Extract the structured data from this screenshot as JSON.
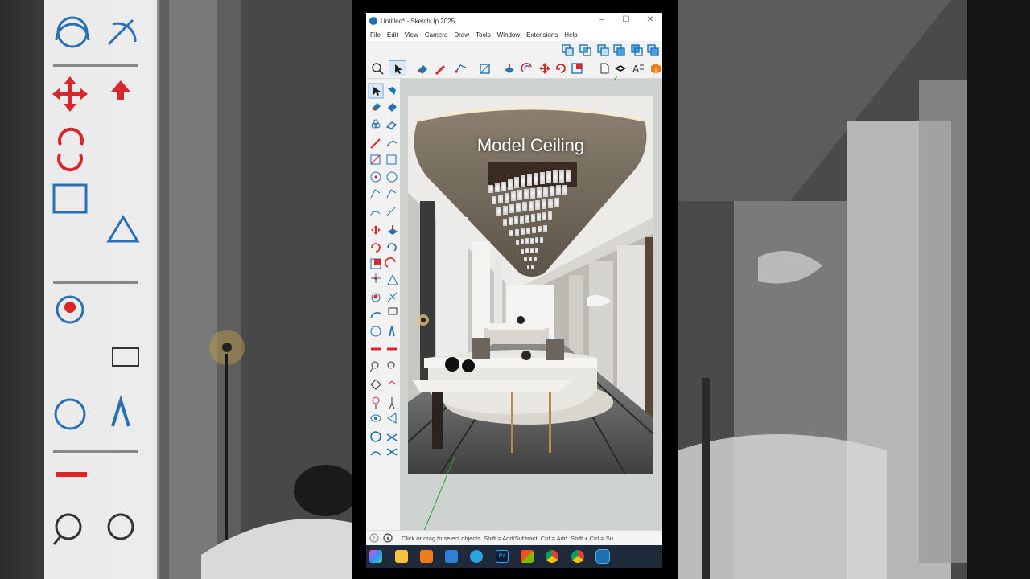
{
  "window": {
    "title": "Untitled* - SketchUp 2025"
  },
  "menu": [
    "File",
    "Edit",
    "View",
    "Camera",
    "Draw",
    "Tools",
    "Window",
    "Extensions",
    "Help"
  ],
  "overlay": {
    "label": "Model Ceiling"
  },
  "status": {
    "text": "Click or drag to select objects. Shift = Add/Subtract. Ctrl = Add. Shift + Ctrl = Su..."
  },
  "taskbar": {
    "apps": [
      "copilot",
      "file-explorer",
      "app-orange",
      "app-blue",
      "telegram",
      "photoshop",
      "store",
      "chrome",
      "chrome",
      "sketchup"
    ]
  },
  "colors": {
    "accent": "#1a6fb5",
    "tool_red": "#d8262b",
    "tool_blue": "#1f74b8"
  }
}
